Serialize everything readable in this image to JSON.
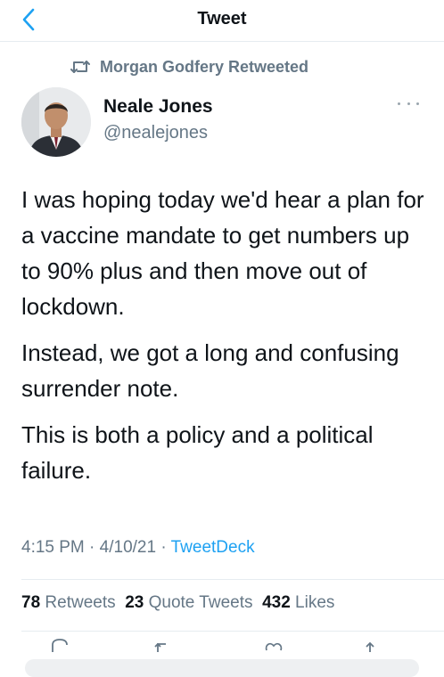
{
  "header": {
    "title": "Tweet"
  },
  "retweet_context": {
    "text": "Morgan Godfery Retweeted"
  },
  "author": {
    "name": "Neale Jones",
    "handle": "@nealejones"
  },
  "tweet": {
    "paragraphs": [
      "I was hoping today we'd hear a plan for a vaccine mandate to get numbers up to 90% plus and then move out of lockdown.",
      "Instead, we got a long and confusing surrender note.",
      "This is both a policy and a political failure."
    ],
    "time": "4:15 PM",
    "date": "4/10/21",
    "source": "TweetDeck"
  },
  "stats": {
    "retweets_count": "78",
    "retweets_label": "Retweets",
    "quotes_count": "23",
    "quotes_label": "Quote Tweets",
    "likes_count": "432",
    "likes_label": "Likes"
  },
  "icons": {
    "back": "chevron-left-icon",
    "retweet": "retweet-icon",
    "more": "more-horizontal-icon",
    "reply": "reply-icon",
    "like": "heart-icon",
    "share": "share-icon"
  },
  "colors": {
    "accent": "#1da1f2",
    "secondary_text": "#657786",
    "divider": "#e6ecf0"
  }
}
